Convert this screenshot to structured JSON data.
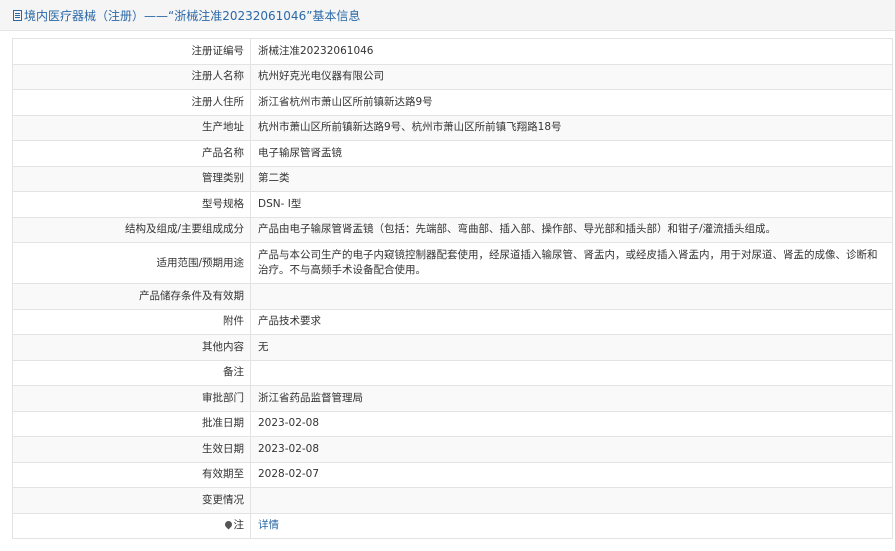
{
  "header": {
    "title": "境内医疗器械（注册）——“浙械注准20232061046”基本信息"
  },
  "rows": [
    {
      "label": "注册证编号",
      "value": "浙械注准20232061046"
    },
    {
      "label": "注册人名称",
      "value": "杭州好克光电仪器有限公司"
    },
    {
      "label": "注册人住所",
      "value": "浙江省杭州市萧山区所前镇新达路9号"
    },
    {
      "label": "生产地址",
      "value": "杭州市萧山区所前镇新达路9号、杭州市萧山区所前镇飞翔路18号"
    },
    {
      "label": "产品名称",
      "value": "电子输尿管肾盂镜"
    },
    {
      "label": "管理类别",
      "value": "第二类"
    },
    {
      "label": "型号规格",
      "value": "DSN- Ⅰ型"
    },
    {
      "label": "结构及组成/主要组成成分",
      "value": "产品由电子输尿管肾盂镜（包括：先端部、弯曲部、插入部、操作部、导光部和插头部）和钳子/灌流插头组成。"
    },
    {
      "label": "适用范围/预期用途",
      "value": "产品与本公司生产的电子内窥镜控制器配套使用，经尿道插入输尿管、肾盂内，或经皮插入肾盂内，用于对尿道、肾盂的成像、诊断和治疗。不与高频手术设备配合使用。"
    },
    {
      "label": "产品储存条件及有效期",
      "value": ""
    },
    {
      "label": "附件",
      "value": "产品技术要求"
    },
    {
      "label": "其他内容",
      "value": "无"
    },
    {
      "label": "备注",
      "value": ""
    },
    {
      "label": "审批部门",
      "value": "浙江省药品监督管理局"
    },
    {
      "label": "批准日期",
      "value": "2023-02-08"
    },
    {
      "label": "生效日期",
      "value": "2023-02-08"
    },
    {
      "label": "有效期至",
      "value": "2028-02-07"
    },
    {
      "label": "变更情况",
      "value": ""
    }
  ],
  "note_row": {
    "icon": "pin-icon",
    "label": "注",
    "link_text": "详情"
  }
}
